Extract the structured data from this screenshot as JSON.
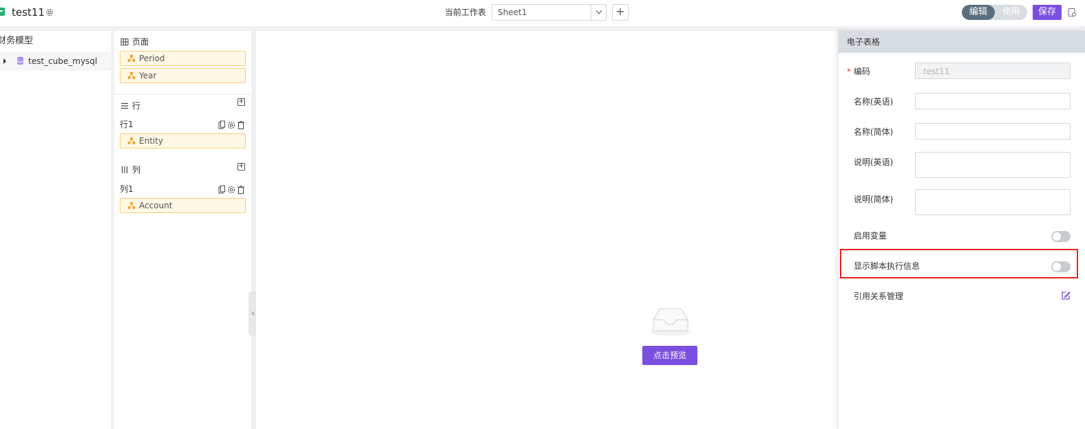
{
  "header": {
    "doc_title": "test11",
    "worksheet_label": "当前工作表",
    "worksheet_value": "Sheet1",
    "add_sheet": "+",
    "mode_edit": "编辑",
    "mode_use": "使用",
    "save": "保存"
  },
  "tree": {
    "heading": "财务模型",
    "items": [
      {
        "label": "test_cube_mysql"
      }
    ]
  },
  "config": {
    "page": {
      "title": "页面",
      "chips": [
        {
          "label": "Period"
        },
        {
          "label": "Year"
        }
      ]
    },
    "rows": {
      "title": "行",
      "groups": [
        {
          "label": "行1",
          "chips": [
            {
              "label": "Entity"
            }
          ]
        }
      ]
    },
    "cols": {
      "title": "列",
      "groups": [
        {
          "label": "列1",
          "chips": [
            {
              "label": "Account"
            }
          ]
        }
      ]
    }
  },
  "canvas": {
    "preview_button": "点击预览"
  },
  "props": {
    "title": "电子表格",
    "fields": {
      "code_label": "编码",
      "code_required": "*",
      "code_value": "test11",
      "name_en_label": "名称(英语)",
      "name_cn_label": "名称(简体)",
      "desc_en_label": "说明(英语)",
      "desc_cn_label": "说明(简体)",
      "enable_var_label": "启用变量",
      "show_script_label": "显示脚本执行信息",
      "ref_manage_label": "引用关系管理"
    },
    "toggles": {
      "enable_var": false,
      "show_script": false
    }
  },
  "colors": {
    "accent": "#7b4fe0",
    "chip_bg": "#fff8e6",
    "chip_border": "#f5cf74",
    "highlight": "#e8231f"
  }
}
